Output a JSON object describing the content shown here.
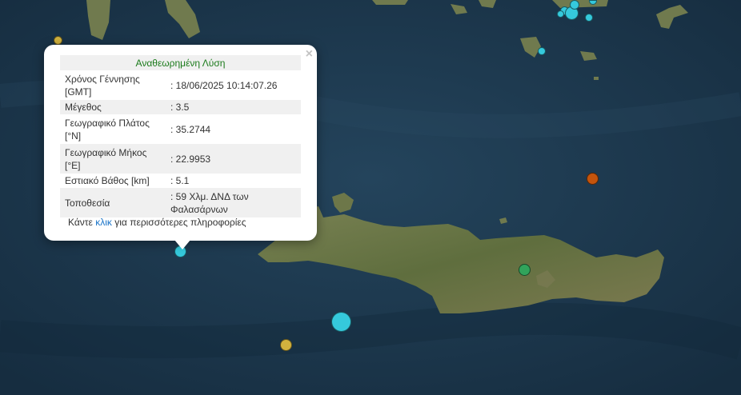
{
  "popup": {
    "title": "Αναθεωρημένη Λύση",
    "close_symbol": "×",
    "rows": [
      {
        "label": "Χρόνος Γέννησης [GMT]",
        "value": ": 18/06/2025 10:14:07.26"
      },
      {
        "label": "Μέγεθος",
        "value": ": 3.5"
      },
      {
        "label": "Γεωγραφικό Πλάτος [°N]",
        "value": ": 35.2744"
      },
      {
        "label": "Γεωγραφικό Μήκος [°E]",
        "value": ": 22.9953"
      },
      {
        "label": "Εστιακό Βάθος [km]",
        "value": ": 5.1"
      },
      {
        "label": "Τοποθεσία",
        "value": ": 59 Χλμ. ΔΝΔ των Φαλασάρνων"
      }
    ],
    "more_prefix": "Κάντε",
    "more_link": "κλικ",
    "more_suffix": "για περισσότερες πληροφορίες"
  },
  "colors": {
    "sea": "#1d3a50",
    "land": "#6f7a4c",
    "cyan_marker": "#35c9dc",
    "yellow_marker": "#d1b23e",
    "orange_marker": "#c4540c",
    "green_marker": "#31a35b",
    "title_green": "#1a7a1a",
    "link_blue": "#1a74c8"
  }
}
